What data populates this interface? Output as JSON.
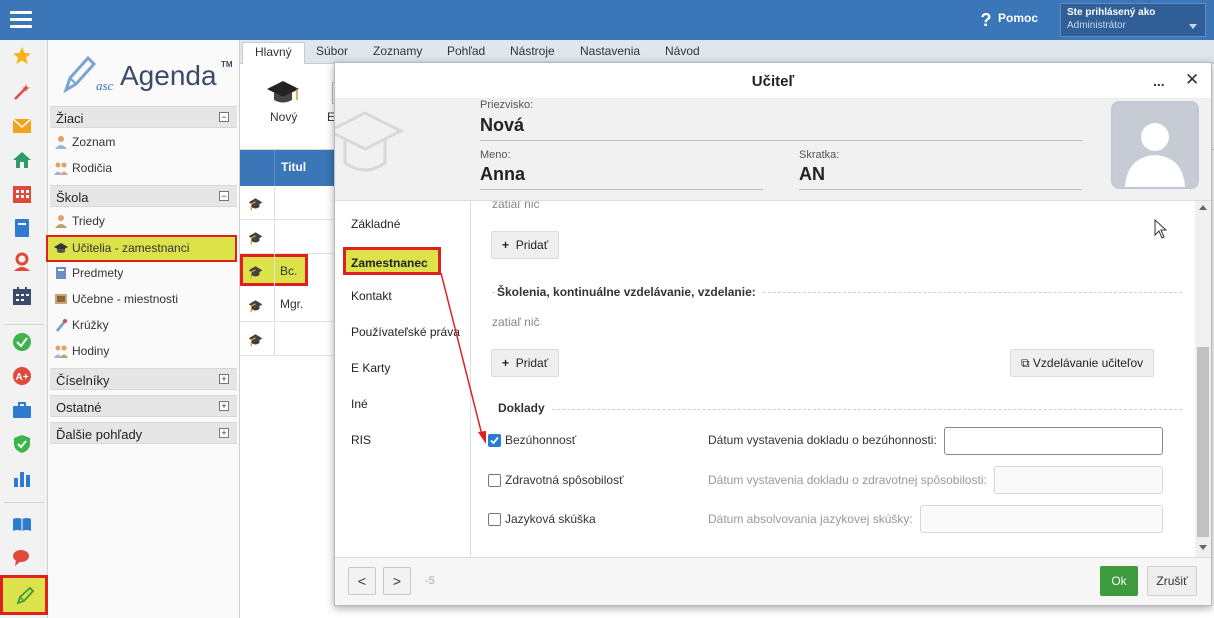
{
  "topbar": {
    "help_label": "Pomoc",
    "user_line1": "Ste prihlásený ako",
    "user_line2": "Administrátor"
  },
  "rail": {
    "icons": [
      "star-icon",
      "magic-wand-icon",
      "envelope-icon",
      "home-icon",
      "calendar-grid-icon",
      "book-icon",
      "person-icon",
      "timetable-icon",
      "check-circle-icon",
      "plus-circle-icon",
      "briefcase-icon",
      "shield-check-icon",
      "bar-chart-icon",
      "open-book-icon",
      "chat-icon",
      "pencil-icon"
    ]
  },
  "logo": {
    "asc": "asc",
    "name": "Agenda",
    "tm": "TM"
  },
  "nav": {
    "sec_ziaci": "Žiaci",
    "zoznam": "Zoznam",
    "rodicia": "Rodičia",
    "sec_skola": "Škola",
    "triedy": "Triedy",
    "ucitelia": "Učitelia - zamestnanci",
    "predmety": "Predmety",
    "ucebne": "Učebne - miestnosti",
    "kruzky": "Krúžky",
    "hodiny": "Hodiny",
    "sec_ciselniky": "Číselníky",
    "sec_ostatne": "Ostatné",
    "sec_dalsie": "Ďalšie pohľady"
  },
  "tabs": [
    "Hlavný",
    "Súbor",
    "Zoznamy",
    "Pohľad",
    "Nástroje",
    "Nastavenia",
    "Návod"
  ],
  "ribbon": {
    "novy": "Nový",
    "edit_partial": "E"
  },
  "grid": {
    "header": "Titul",
    "rows": [
      "",
      "",
      "Bc.",
      "Mgr.",
      ""
    ]
  },
  "dialog": {
    "title": "Učiteľ",
    "more": "...",
    "close": "✕",
    "priezvisko_label": "Priezvisko:",
    "priezvisko": "Nová",
    "meno_label": "Meno:",
    "meno": "Anna",
    "skratka_label": "Skratka:",
    "skratka": "AN",
    "left_tabs": [
      "Základné",
      "Zamestnanec",
      "Kontakt",
      "Používateľské práva",
      "E Karty",
      "Iné",
      "RIS"
    ],
    "zatial_nic_top": "zatiaľ nič",
    "pridat1": "Pridať",
    "skolenia_title": "Školenia, kontinuálne vzdelávanie, vzdelanie:",
    "zatial_nic": "zatiaľ nič",
    "pridat2": "Pridať",
    "vzdelavanie": "Vzdelávanie učiteľov",
    "doklady_title": "Doklady",
    "bezuhonnost": "Bezúhonnosť",
    "bezuhonnost_checked": true,
    "datum_bez_label": "Dátum vystavenia dokladu o bezúhonnosti:",
    "zdravotna": "Zdravotná spôsobilosť",
    "datum_zdrav_label": "Dátum vystavenia dokladu o zdravotnej spôsobilosti:",
    "jazykova": "Jazyková skúška",
    "datum_jaz_label": "Dátum absolvovania jazykovej skúšky:",
    "nav_prev": "<",
    "nav_next": ">",
    "counter": "-5",
    "ok": "Ok",
    "zrusit": "Zrušiť"
  },
  "colors": {
    "topbar": "#3a76b8",
    "highlight": "#dce34a",
    "annotation_red": "#e02020",
    "ok_green": "#3d9b3d"
  }
}
